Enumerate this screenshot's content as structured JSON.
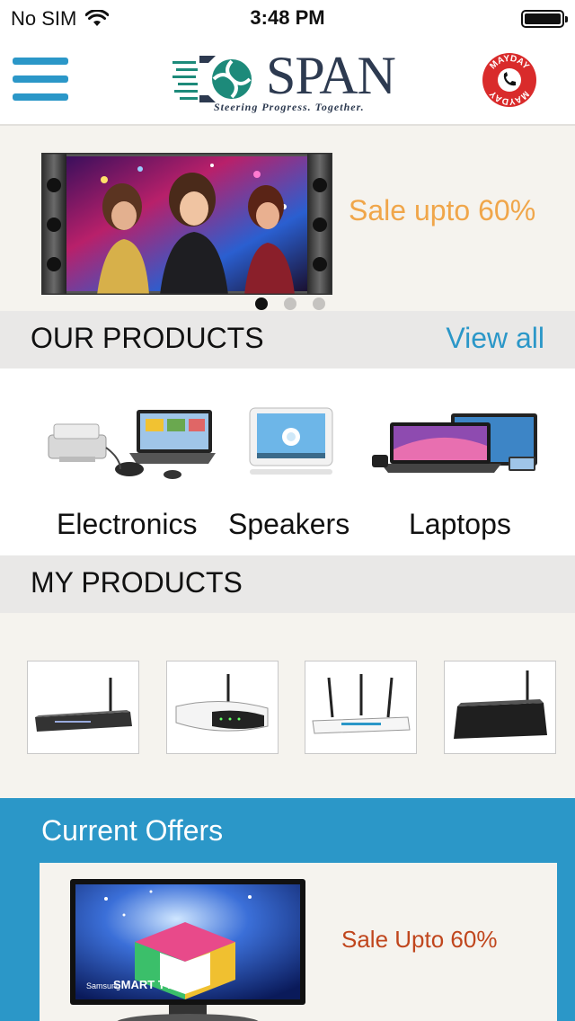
{
  "status_bar": {
    "carrier": "No SIM",
    "time": "3:48 PM"
  },
  "header": {
    "logo_text": "SPAN",
    "logo_tagline": "Steering Progress. Together.",
    "mayday_badge": "MAYDAY"
  },
  "banner": {
    "sale_text": "Sale upto 60%",
    "slides": 3,
    "active_slide": 1
  },
  "our_products": {
    "title": "OUR PRODUCTS",
    "view_all": "View all",
    "items": [
      {
        "label": "Electronics",
        "icon": "printer-laptop-image"
      },
      {
        "label": "Speakers",
        "icon": "tablet-image"
      },
      {
        "label": "Laptops",
        "icon": "laptops-image"
      }
    ]
  },
  "my_products": {
    "title": "MY PRODUCTS",
    "items": [
      {
        "icon": "router-image-1"
      },
      {
        "icon": "router-image-2"
      },
      {
        "icon": "router-image-3"
      },
      {
        "icon": "router-image-4"
      }
    ]
  },
  "offers": {
    "title": "Current Offers",
    "card": {
      "text": "Sale Upto 60%",
      "tv_brand": "Samsung",
      "tv_label": "SMART TV"
    }
  },
  "colors": {
    "accent_blue": "#2b97c8",
    "banner_sale": "#f0a64a",
    "offer_sale": "#c0461d",
    "page_bg": "#f5f3ee",
    "section_bg": "#e9e8e7"
  }
}
